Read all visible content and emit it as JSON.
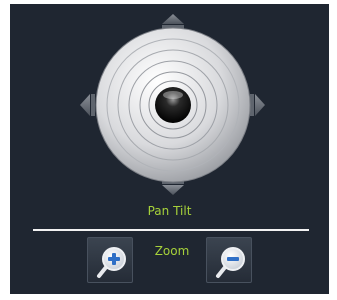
{
  "ptz": {
    "pan_tilt_label": "Pan Tilt",
    "zoom_label": "Zoom"
  },
  "icons": {
    "arrow_up": "arrow-up-icon",
    "arrow_down": "arrow-down-icon",
    "arrow_left": "arrow-left-icon",
    "arrow_right": "arrow-right-icon",
    "zoom_in": "zoom-in-icon",
    "zoom_out": "zoom-out-icon"
  },
  "colors": {
    "background": "#1f2631",
    "label": "#a6d13a",
    "divider": "#f2f2f2"
  }
}
